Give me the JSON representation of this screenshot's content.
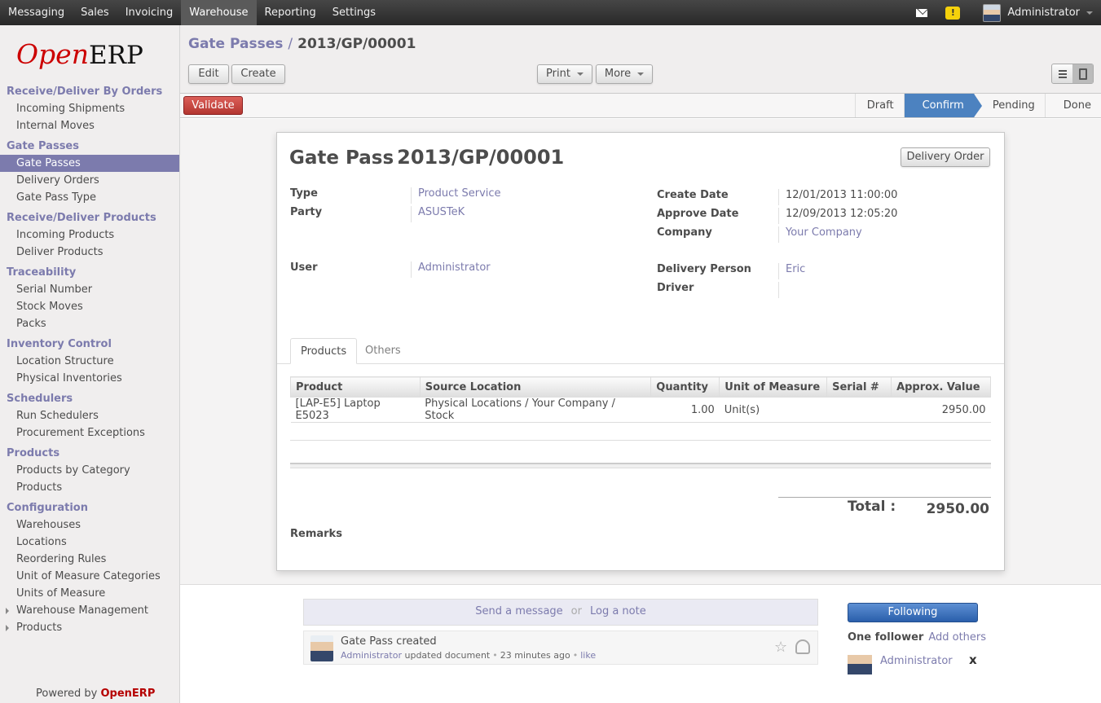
{
  "topmenu": {
    "items": [
      "Messaging",
      "Sales",
      "Invoicing",
      "Warehouse",
      "Reporting",
      "Settings"
    ],
    "active": "Warehouse",
    "user": "Administrator"
  },
  "sidebar": {
    "logo_open": "Open",
    "logo_erp": "ERP",
    "sections": [
      {
        "title": "Receive/Deliver By Orders",
        "items": [
          "Incoming Shipments",
          "Internal Moves"
        ]
      },
      {
        "title": "Gate Passes",
        "items": [
          "Gate Passes",
          "Delivery Orders",
          "Gate Pass Type"
        ]
      },
      {
        "title": "Receive/Deliver Products",
        "items": [
          "Incoming Products",
          "Deliver Products"
        ]
      },
      {
        "title": "Traceability",
        "items": [
          "Serial Number",
          "Stock Moves",
          "Packs"
        ]
      },
      {
        "title": "Inventory Control",
        "items": [
          "Location Structure",
          "Physical Inventories"
        ]
      },
      {
        "title": "Schedulers",
        "items": [
          "Run Schedulers",
          "Procurement Exceptions"
        ]
      },
      {
        "title": "Products",
        "items": [
          "Products by Category",
          "Products"
        ]
      },
      {
        "title": "Configuration",
        "items": [
          "Warehouses",
          "Locations",
          "Reordering Rules",
          "Unit of Measure Categories",
          "Units of Measure",
          "Warehouse Management",
          "Products"
        ]
      }
    ],
    "powered_prefix": "Powered by",
    "powered_brand": "OpenERP"
  },
  "header": {
    "breadcrumb_parent": "Gate Passes",
    "breadcrumb_sep": "/",
    "breadcrumb_current": "2013/GP/00001",
    "edit": "Edit",
    "create": "Create",
    "print": "Print",
    "more": "More"
  },
  "statusbar": {
    "validate": "Validate",
    "stages": [
      "Draft",
      "Confirm",
      "Pending",
      "Done"
    ],
    "active_stage": "Confirm"
  },
  "form": {
    "title_prefix": "Gate Pass",
    "title_number": "2013/GP/00001",
    "delivery_order_button": "Delivery Order",
    "type_label": "Type",
    "type_value": "Product Service",
    "party_label": "Party",
    "party_value": "ASUSTeK",
    "user_label": "User",
    "user_value": "Administrator",
    "create_date_label": "Create Date",
    "create_date_value": "12/01/2013 11:00:00",
    "approve_date_label": "Approve Date",
    "approve_date_value": "12/09/2013 12:05:20",
    "company_label": "Company",
    "company_value": "Your Company",
    "delivery_person_label": "Delivery Person",
    "delivery_person_value": "Eric",
    "driver_label": "Driver",
    "driver_value": "",
    "tabs": [
      "Products",
      "Others"
    ],
    "table": {
      "columns": [
        "Product",
        "Source Location",
        "Quantity",
        "Unit of Measure",
        "Serial #",
        "Approx. Value"
      ],
      "rows": [
        [
          "[LAP-E5] Laptop E5023",
          "Physical Locations / Your Company / Stock",
          "1.00",
          "Unit(s)",
          "",
          "2950.00"
        ]
      ]
    },
    "total_label": "Total :",
    "total_value": "2950.00",
    "remarks_label": "Remarks"
  },
  "chatter": {
    "send_message": "Send a message",
    "or": "or",
    "log_note": "Log a note",
    "message_title": "Gate Pass created",
    "message_author": "Administrator",
    "message_action": "updated document",
    "message_time": "23 minutes ago",
    "message_like": "like",
    "following": "Following",
    "follower_count": "One follower",
    "add_others": "Add others",
    "follower_name": "Administrator",
    "remove_glyph": "x"
  }
}
